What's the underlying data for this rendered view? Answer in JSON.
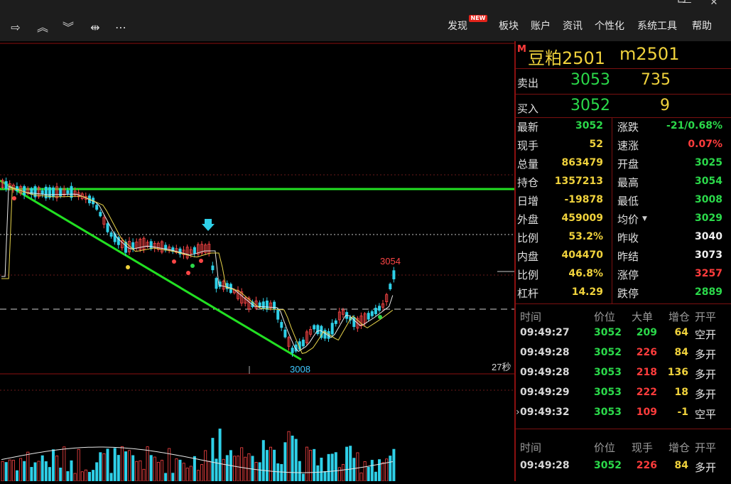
{
  "toolbar": {
    "menu": [
      "发现",
      "板块",
      "账户",
      "资讯",
      "个性化",
      "系统工具",
      "帮助"
    ],
    "new_badge": "NEW"
  },
  "chart": {
    "high_label": "3054",
    "low_label": "3008",
    "countdown": "27秒"
  },
  "quote": {
    "market_badge": "M",
    "name": "豆粕2501",
    "code": "m2501",
    "sell_label": "卖出",
    "sell_price": "3053",
    "sell_volume": "735",
    "buy_label": "买入",
    "buy_price": "3052",
    "buy_volume": "9",
    "stats_left": [
      {
        "label": "最新",
        "value": "3052",
        "color": "#2bd94a"
      },
      {
        "label": "现手",
        "value": "52",
        "color": "#f0d23c"
      },
      {
        "label": "总量",
        "value": "863479",
        "color": "#f0d23c"
      },
      {
        "label": "持仓",
        "value": "1357213",
        "color": "#f0d23c"
      },
      {
        "label": "日增",
        "value": "-19878",
        "color": "#f0d23c"
      },
      {
        "label": "外盘",
        "value": "459009",
        "color": "#f0d23c"
      },
      {
        "label": "比例",
        "value": "53.2%",
        "color": "#f0d23c"
      },
      {
        "label": "内盘",
        "value": "404470",
        "color": "#f0d23c"
      },
      {
        "label": "比例",
        "value": "46.8%",
        "color": "#f0d23c"
      },
      {
        "label": "杠杆",
        "value": "14.29",
        "color": "#f0d23c"
      }
    ],
    "stats_right": [
      {
        "label": "涨跌",
        "value": "-21/0.68%",
        "color": "#2bd94a"
      },
      {
        "label": "速涨",
        "value": "0.07%",
        "color": "#ff3c3c"
      },
      {
        "label": "开盘",
        "value": "3025",
        "color": "#2bd94a"
      },
      {
        "label": "最高",
        "value": "3054",
        "color": "#2bd94a"
      },
      {
        "label": "最低",
        "value": "3008",
        "color": "#2bd94a"
      },
      {
        "label": "均价",
        "value": "3029",
        "color": "#2bd94a"
      },
      {
        "label": "昨收",
        "value": "3040",
        "color": "#f0f0f0"
      },
      {
        "label": "昨结",
        "value": "3073",
        "color": "#f0f0f0"
      },
      {
        "label": "涨停",
        "value": "3257",
        "color": "#ff3c3c"
      },
      {
        "label": "跌停",
        "value": "2889",
        "color": "#2bd94a"
      }
    ]
  },
  "ticks": {
    "headers": [
      "时间",
      "价位",
      "大单",
      "增仓",
      "开平"
    ],
    "rows": [
      {
        "time": "09:49:27",
        "price": "3052",
        "size": "209",
        "delta": "64",
        "type": "空开",
        "size_color": "#2bd94a"
      },
      {
        "time": "09:49:28",
        "price": "3052",
        "size": "226",
        "delta": "84",
        "type": "多开",
        "size_color": "#ff3c3c"
      },
      {
        "time": "09:49:28",
        "price": "3053",
        "size": "218",
        "delta": "136",
        "type": "多开",
        "size_color": "#ff3c3c"
      },
      {
        "time": "09:49:29",
        "price": "3053",
        "size": "222",
        "delta": "18",
        "type": "多开",
        "size_color": "#ff3c3c"
      },
      {
        "time": "09:49:32",
        "price": "3053",
        "size": "109",
        "delta": "-1",
        "type": "空平",
        "size_color": "#ff3c3c"
      }
    ]
  },
  "ticks2": {
    "headers": [
      "时间",
      "价位",
      "现手",
      "增仓",
      "开平"
    ],
    "rows": [
      {
        "time": "09:49:28",
        "price": "3052",
        "size": "226",
        "delta": "84",
        "type": "多开",
        "size_color": "#ff3c3c"
      }
    ]
  }
}
